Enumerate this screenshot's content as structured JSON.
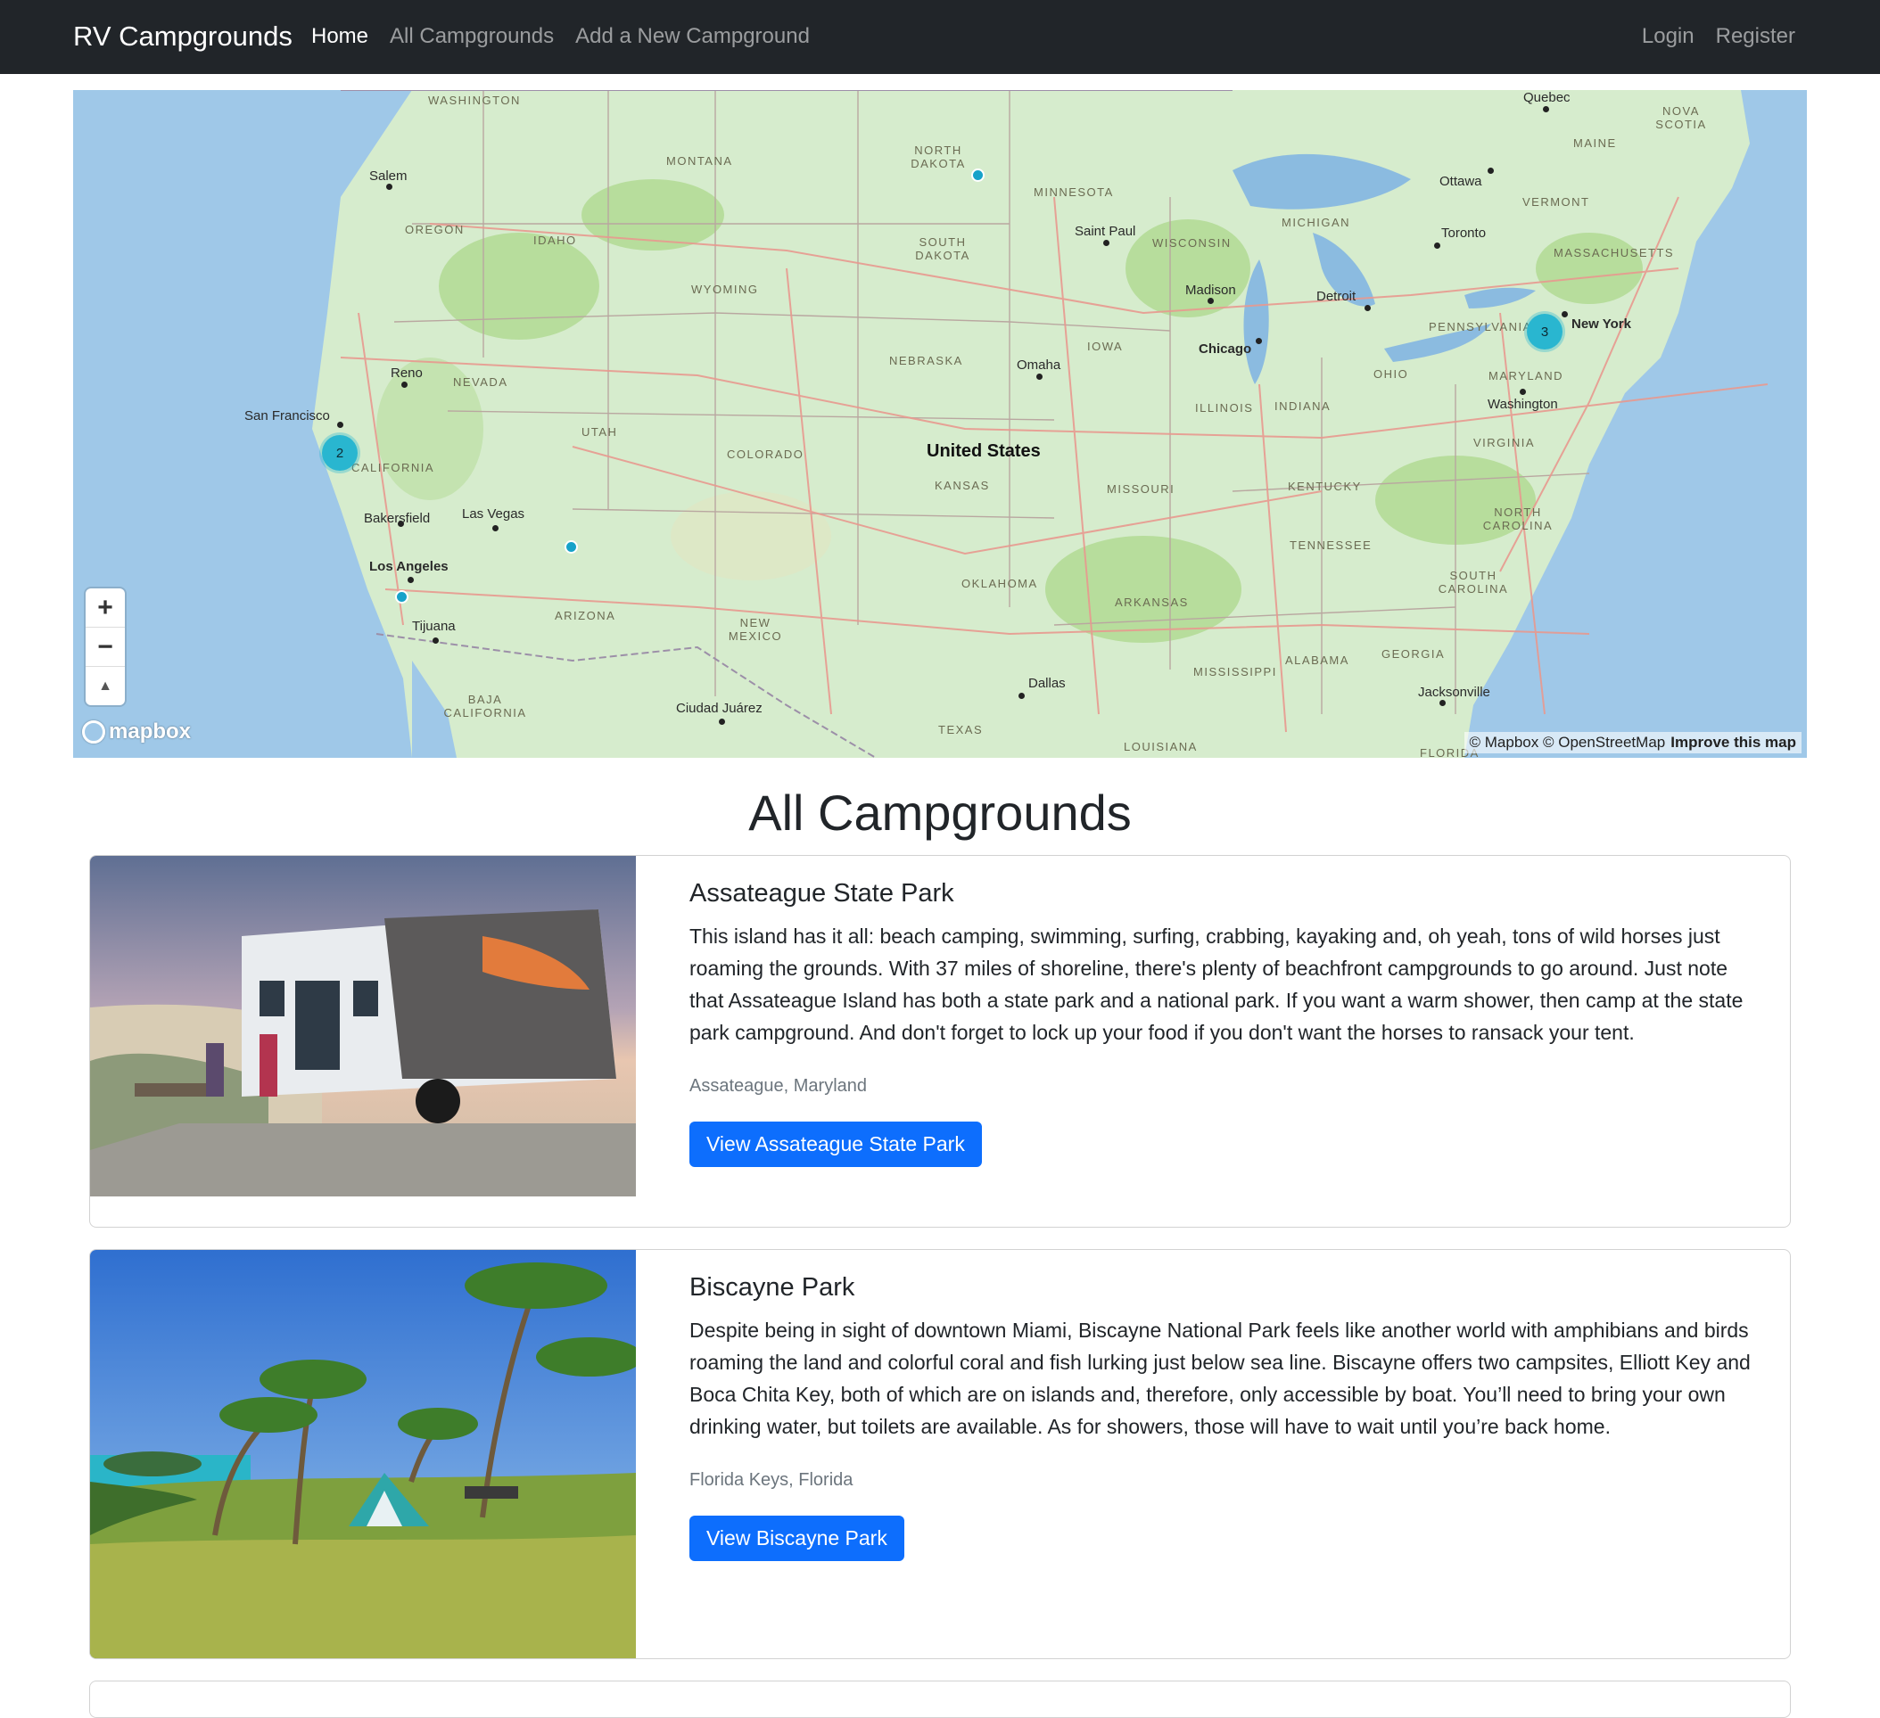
{
  "nav": {
    "brand": "RV Campgrounds",
    "links": [
      "Home",
      "All Campgrounds",
      "Add a New Campground"
    ],
    "right_links": [
      "Login",
      "Register"
    ]
  },
  "map": {
    "country": "United States",
    "states": [
      "Washington",
      "Montana",
      "North Dakota",
      "Minnesota",
      "Oregon",
      "Idaho",
      "South Dakota",
      "Wisconsin",
      "Michigan",
      "Wyoming",
      "Nebraska",
      "Iowa",
      "Nevada",
      "Utah",
      "Colorado",
      "Kansas",
      "Missouri",
      "Illinois",
      "Indiana",
      "Ohio",
      "Pennsylvania",
      "Maryland",
      "Virginia",
      "Kentucky",
      "California",
      "Arizona",
      "New Mexico",
      "Oklahoma",
      "Arkansas",
      "Tennessee",
      "North Carolina",
      "South Carolina",
      "Mississippi",
      "Alabama",
      "Georgia",
      "Texas",
      "Louisiana",
      "Baja California",
      "Vermont",
      "Maine",
      "Nova Scotia",
      "Massachusetts",
      "Florida"
    ],
    "cities": [
      "Salem",
      "Saint Paul",
      "Ottawa",
      "Toronto",
      "Quebec",
      "Madison",
      "Detroit",
      "Chicago",
      "New York",
      "Omaha",
      "Reno",
      "San Francisco",
      "Washington",
      "Las Vegas",
      "Bakersfield",
      "Los Angeles",
      "Tijuana",
      "Dallas",
      "Ciudad Juárez",
      "Jacksonville"
    ],
    "clusters": [
      "2",
      "3"
    ],
    "zoom_in": "+",
    "zoom_out": "−",
    "compass": "▲",
    "logo": "mapbox",
    "attribution": "© Mapbox © OpenStreetMap",
    "improve": "Improve this map"
  },
  "heading": "All Campgrounds",
  "campgrounds": [
    {
      "title": "Assateague State Park",
      "description": "This island has it all: beach camping, swimming, surfing, crabbing, kayaking and, oh yeah, tons of wild horses just roaming the grounds. With 37 miles of shoreline, there's plenty of beachfront campgrounds to go around. Just note that Assateague Island has both a state park and a national park. If you want a warm shower, then camp at the state park campground. And don't forget to lock up your food if you don't want the horses to ransack your tent.",
      "location": "Assateague, Maryland",
      "button": "View Assateague State Park"
    },
    {
      "title": "Biscayne Park",
      "description": "Despite being in sight of downtown Miami, Biscayne National Park feels like another world with amphibians and birds roaming the land and colorful coral and fish lurking just below sea line. Biscayne offers two campsites, Elliott Key and Boca Chita Key, both of which are on islands and, therefore, only accessible by boat. You’ll need to bring your own drinking water, but toilets are available. As for showers, those will have to wait until you’re back home.",
      "location": "Florida Keys, Florida",
      "button": "View Biscayne Park"
    }
  ]
}
